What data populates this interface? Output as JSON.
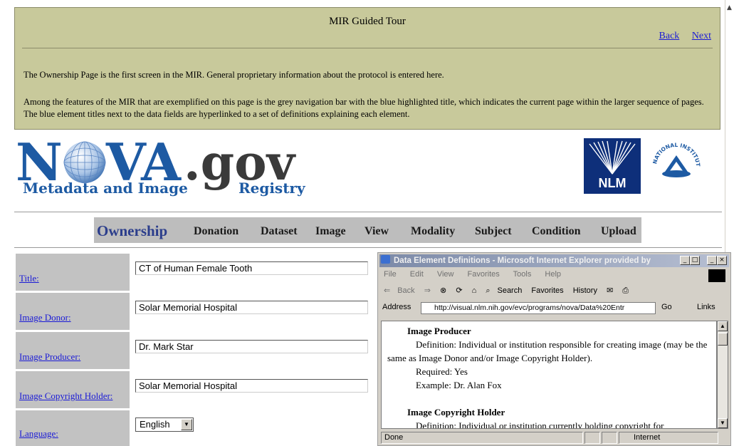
{
  "tour": {
    "title": "MIR Guided Tour",
    "back": "Back",
    "next": "Next",
    "p1": "The Ownership Page is the first screen in the MIR. General proprietary information about the protocol is entered here.",
    "p2": "Among the features of the MIR that are exemplified on this page is the grey navigation bar with the blue highlighted title, which indicates the current page within the larger sequence of pages. The blue element titles next to the data fields are hyperlinked to a set of definitions explaining each element."
  },
  "logo": {
    "main_n": "N",
    "main_va": "VA",
    "gov": ".gov",
    "sub": "Metadata and Image",
    "registry": "Registry",
    "nlm": "NLM",
    "nih": "NATIONAL INSTITUTES OF HEALTH"
  },
  "nav": [
    "Ownership",
    "Donation",
    "Dataset",
    "Image",
    "View",
    "Modality",
    "Subject",
    "Condition",
    "Upload"
  ],
  "form": {
    "title_label": "Title:",
    "title_value": "CT of Human Female Tooth",
    "donor_label": "Image Donor:",
    "donor_value": "Solar Memorial Hospital",
    "producer_label": "Image Producer:",
    "producer_value": "Dr. Mark Star",
    "copyright_label": "Image Copyright Holder:",
    "copyright_value": "Solar Memorial Hospital",
    "language_label": "Language:",
    "language_value": "English"
  },
  "popup": {
    "window_title": "Data Element Definitions - Microsoft Internet Explorer provided by",
    "menu": [
      "File",
      "Edit",
      "View",
      "Favorites",
      "Tools",
      "Help"
    ],
    "toolbar": {
      "back": "Back",
      "search": "Search",
      "favorites": "Favorites",
      "history": "History"
    },
    "address_label": "Address",
    "url": "http://visual.nlm.nih.gov/evc/programs/nova/Data%20Entr",
    "go": "Go",
    "links": "Links",
    "content": {
      "h1": "Image Producer",
      "def1": "Definition: Individual or institution responsible for creating image (may be the same as Image Donor and/or Image Copyright Holder).",
      "req1": "Required: Yes",
      "ex1": "Example: Dr. Alan Fox",
      "h2": "Image Copyright Holder",
      "def2": "Definition: Individual or institution currently holding copyright for"
    },
    "status": "Done",
    "zone": "Internet"
  },
  "colors": {
    "tour_bg": "#c8c99b",
    "nav_bg": "#bdbdbd",
    "label_bg": "#c2c2c2",
    "brand_blue": "#1d5aa3",
    "link_blue": "#1a1ad6"
  }
}
